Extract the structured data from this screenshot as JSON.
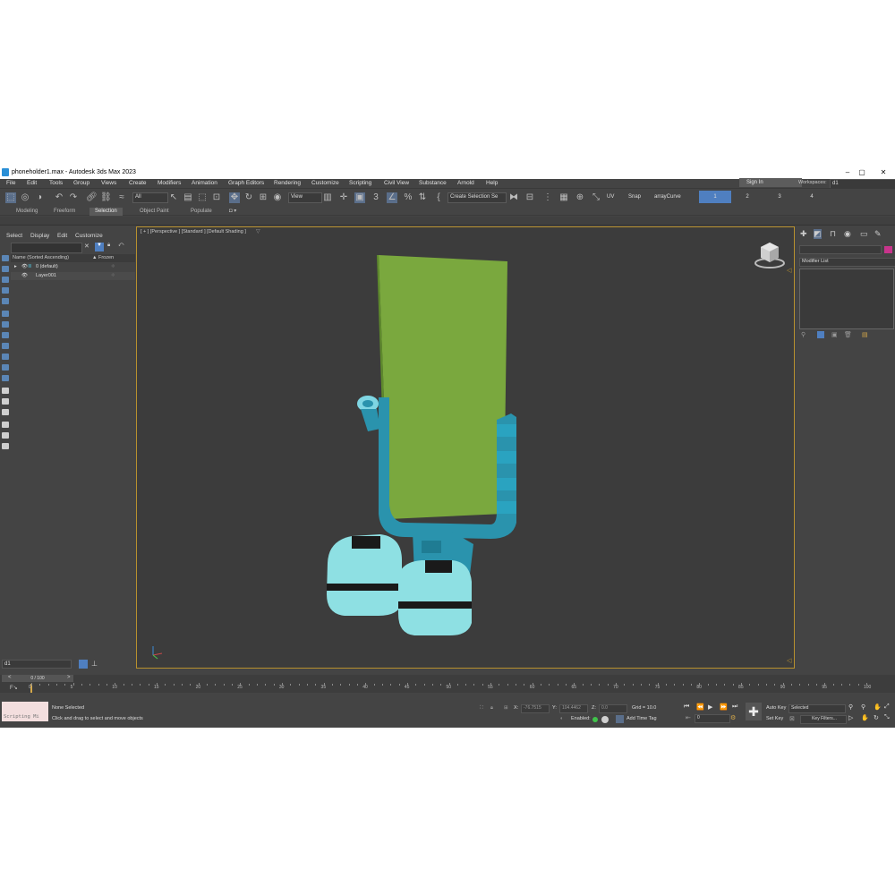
{
  "window": {
    "title": "phoneholder1.max - Autodesk 3ds Max 2023",
    "minimize": "–",
    "maximize": "▢",
    "close": "✕"
  },
  "menu": [
    "File",
    "Edit",
    "Tools",
    "Group",
    "Views",
    "Create",
    "Modifiers",
    "Animation",
    "Graph Editors",
    "Rendering",
    "Customize",
    "Scripting",
    "Civil View",
    "Substance",
    "Arnold",
    "Help"
  ],
  "signin": "Sign In",
  "workspaces": {
    "label": "Workspaces:",
    "value": "d1"
  },
  "toolbar": {
    "filter_dropdown": "All",
    "view_dropdown": "View",
    "create_selection": "Create Selection Se",
    "uv_label": "UV",
    "snap_label": "Snap",
    "array_curve_label": "arrayCurve",
    "tabs": [
      "1",
      "2",
      "3",
      "4"
    ]
  },
  "ribbon": {
    "tabs": [
      "Modeling",
      "Freeform",
      "Selection",
      "Object Paint",
      "Populate"
    ],
    "active": "Selection"
  },
  "scene_explorer": {
    "menus": [
      "Select",
      "Display",
      "Edit",
      "Customize"
    ],
    "header_name": "Name (Sorted Ascending)",
    "header_frozen": "▲ Frozen",
    "rows": [
      "0 (default)",
      "Layer001"
    ]
  },
  "viewport": {
    "label": "[ + ] [Perspective ] [Standard ] [Default Shading ]"
  },
  "command_panel": {
    "modifier_list": "Modifier List"
  },
  "timeline": {
    "slider": "0 / 100",
    "ticks": [
      "0",
      "5",
      "10",
      "15",
      "20",
      "25",
      "30",
      "35",
      "40",
      "45",
      "50",
      "55",
      "60",
      "65",
      "70",
      "75",
      "80",
      "85",
      "90",
      "95",
      "100"
    ]
  },
  "layer_field": "d1",
  "status": {
    "script_listener": "Scripting Mi",
    "none_selected": "None Selected",
    "hint": "Click and drag to select and move objects",
    "x_label": "X:",
    "x_value": "-76.7515",
    "y_label": "Y:",
    "y_value": "104.4462",
    "z_label": "Z:",
    "z_value": "0.0",
    "grid": "Grid = 10.0",
    "enabled": "Enabled:",
    "add_time_tag": "Add Time Tag",
    "auto_key": "Auto Key",
    "selected": "Selected",
    "set_key": "Set Key",
    "key_filters": "Key Filters...",
    "frame": "0"
  }
}
